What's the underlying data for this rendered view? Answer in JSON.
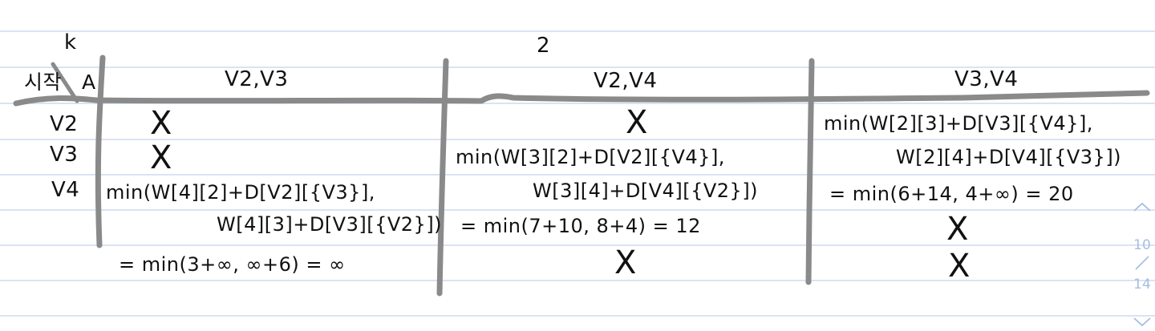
{
  "note": {
    "header": {
      "corner_k": "k",
      "top_num": "2",
      "corner_i": "시작",
      "corner_a": "A"
    },
    "columns": [
      "V2,V3",
      "V2,V4",
      "V3,V4"
    ],
    "rows": [
      "V2",
      "V3",
      "V4"
    ],
    "col1": {
      "v2": "X",
      "v3": "X",
      "v4_line1": "min(W[4][2]+D[V2][{V3}],",
      "v4_line2": "W[4][3]+D[V3][{V2}])",
      "v4_line3": "= min(3+∞, ∞+6) = ∞"
    },
    "col2": {
      "v2": "X",
      "v3_line1": "min(W[3][2]+D[V2][{V4}],",
      "v3_line2": "W[3][4]+D[V4][{V2}])",
      "v3_line3": "= min(7+10, 8+4) = 12",
      "v4": "X"
    },
    "col3": {
      "v2_line1": "min(W[2][3]+D[V3][{V4}],",
      "v2_line2": "W[2][4]+D[V4][{V3}])",
      "v2_line3": "= min(6+14, 4+∞) = 20",
      "v3": "X",
      "v4": "X"
    },
    "page_indicator": {
      "current": "10",
      "total": "14"
    },
    "colors": {
      "rule_line": "#c4d2ec",
      "ink": "#111111",
      "table_marker": "#8a8a8a",
      "indicator": "#a6bde2"
    }
  }
}
